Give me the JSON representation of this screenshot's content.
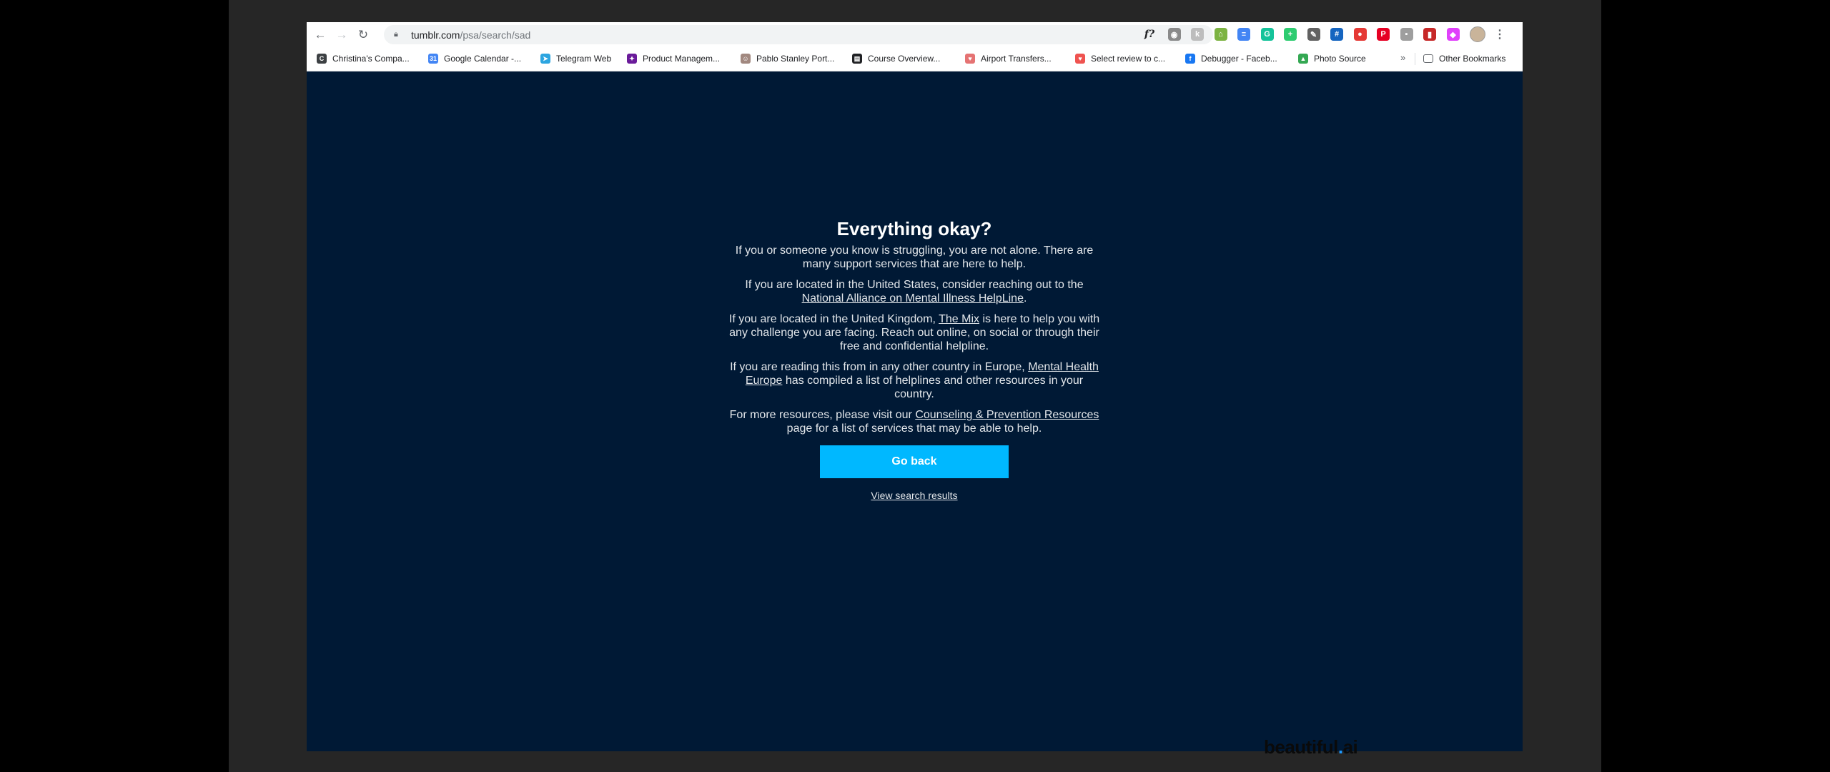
{
  "browser": {
    "url_host": "tumblr.com",
    "url_path": "/psa/search/sad",
    "extensions": [
      {
        "icon": "function-icon",
        "label": "f?",
        "color": "#202124"
      },
      {
        "icon": "camera-icon",
        "label": "◉",
        "color": "#8a8a8a"
      },
      {
        "icon": "k-extension-icon",
        "label": "k",
        "color": "#bdbdbd"
      },
      {
        "icon": "green-extension-icon",
        "label": "⌂",
        "color": "#7cb342"
      },
      {
        "icon": "docs-extension-icon",
        "label": "≡",
        "color": "#4285f4"
      },
      {
        "icon": "grammarly-icon",
        "label": "G",
        "color": "#15c39a"
      },
      {
        "icon": "green-plus-icon",
        "label": "+",
        "color": "#2ecc71"
      },
      {
        "icon": "eyedropper-icon",
        "label": "✎",
        "color": "#616161"
      },
      {
        "icon": "hashtag-icon",
        "label": "#",
        "color": "#1565c0"
      },
      {
        "icon": "adblock-icon",
        "label": "●",
        "color": "#e53935"
      },
      {
        "icon": "pinterest-icon",
        "label": "P",
        "color": "#e60023"
      },
      {
        "icon": "grey-extension-icon",
        "label": "▪",
        "color": "#9e9e9e"
      },
      {
        "icon": "red-book-icon",
        "label": "▮",
        "color": "#c62828"
      },
      {
        "icon": "gradient-extension-icon",
        "label": "◆",
        "color": "#e040fb"
      }
    ]
  },
  "bookmarks": {
    "items": [
      {
        "label": "Christina's Compa...",
        "icon": "compass-icon",
        "color": "#3c4043",
        "glyph": "C"
      },
      {
        "label": "Google Calendar -...",
        "icon": "calendar-icon",
        "color": "#4285f4",
        "glyph": "31"
      },
      {
        "label": "Telegram Web",
        "icon": "telegram-icon",
        "color": "#2ca5e0",
        "glyph": "➤"
      },
      {
        "label": "Product Managem...",
        "icon": "product-icon",
        "color": "#6a1b9a",
        "glyph": "✦"
      },
      {
        "label": "Pablo Stanley Port...",
        "icon": "pablo-icon",
        "color": "#a1887f",
        "glyph": "☺"
      },
      {
        "label": "Course Overview...",
        "icon": "document-icon",
        "color": "#202124",
        "glyph": "▤"
      },
      {
        "label": "Airport Transfers...",
        "icon": "airport-icon",
        "color": "#e57373",
        "glyph": "♥"
      },
      {
        "label": "Select review to c...",
        "icon": "review-icon",
        "color": "#ef5350",
        "glyph": "♥"
      },
      {
        "label": "Debugger - Faceb...",
        "icon": "facebook-icon",
        "color": "#1877f2",
        "glyph": "f"
      },
      {
        "label": "Photo Source",
        "icon": "drive-icon",
        "color": "#34a853",
        "glyph": "▲"
      }
    ],
    "other": {
      "label": "Other Bookmarks",
      "icon": "folder-icon"
    }
  },
  "psa": {
    "title": "Everything okay?",
    "p1": "If you or someone you know is struggling, you are not alone. There are many support services that are here to help.",
    "p2_text": "If you are located in the United States, consider reaching out to the ",
    "p2_link": "National Alliance on Mental Illness HelpLine",
    "p2_end": ".",
    "p3_text": "If you are located in the United Kingdom, ",
    "p3_link": "The Mix",
    "p3_end": " is here to help you with any challenge you are facing.  Reach out online, on social or through their free and confidential helpline.",
    "p4_text": "If you are reading this from in any other country in Europe,  ",
    "p4_link": "Mental Health Europe",
    "p4_end": " has compiled a list of helplines and other resources in your country.",
    "p5_text": "For more resources, please visit our ",
    "p5_link": "Counseling & Prevention Resources",
    "p5_end": " page for a list of services that may be able to help.",
    "go_back": "Go back",
    "view_results": "View search results"
  },
  "watermark": {
    "word": "beautiful",
    "dot": ".",
    "suffix": "ai"
  }
}
